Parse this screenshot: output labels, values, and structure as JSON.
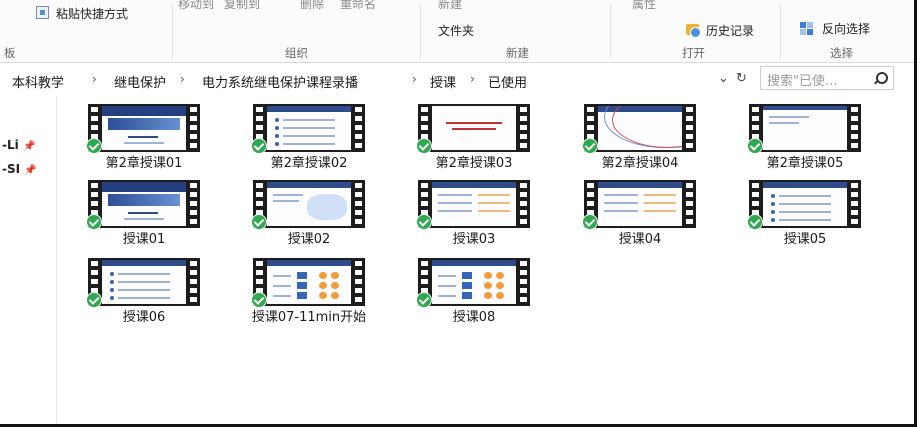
{
  "ribbon": {
    "paste_shortcut": "粘贴快捷方式",
    "move_to": "移动到",
    "copy_to": "复制到",
    "delete": "删除",
    "rename": "重命名",
    "new_folder_line1": "新建",
    "new_folder_line2": "文件夹",
    "properties": "属性",
    "history": "历史记录",
    "invert_selection": "反向选择",
    "group_clipboard": "板",
    "group_organize": "组织",
    "group_new": "新建",
    "group_open": "打开",
    "group_select": "选择"
  },
  "address": {
    "crumbs": [
      "本科教学",
      "继电保护",
      "电力系统继电保护课程录播",
      "授课",
      "已使用"
    ],
    "separator": "›",
    "dropdown": "⌄",
    "refresh": "↻"
  },
  "search": {
    "placeholder": "搜索\"已使..."
  },
  "nav": {
    "items": [
      {
        "label": "-Li",
        "pin": "📌"
      },
      {
        "label": "-SI",
        "pin": "📌"
      }
    ]
  },
  "files": [
    {
      "name": "第2章授课01",
      "status": "synced"
    },
    {
      "name": "第2章授课02",
      "status": "synced"
    },
    {
      "name": "第2章授课03",
      "status": "synced"
    },
    {
      "name": "第2章授课04",
      "status": "synced"
    },
    {
      "name": "第2章授课05",
      "status": "synced"
    },
    {
      "name": "授课01",
      "status": "synced"
    },
    {
      "name": "授课02",
      "status": "synced"
    },
    {
      "name": "授课03",
      "status": "synced"
    },
    {
      "name": "授课04",
      "status": "synced"
    },
    {
      "name": "授课05",
      "status": "synced"
    },
    {
      "name": "授课06",
      "status": "synced"
    },
    {
      "name": "授课07-11min开始",
      "status": "synced"
    },
    {
      "name": "授课08",
      "status": "synced"
    }
  ],
  "colors": {
    "sync_check": "#2fa84f",
    "film_strip": "#1d1d1d",
    "accent": "#3566b8"
  }
}
